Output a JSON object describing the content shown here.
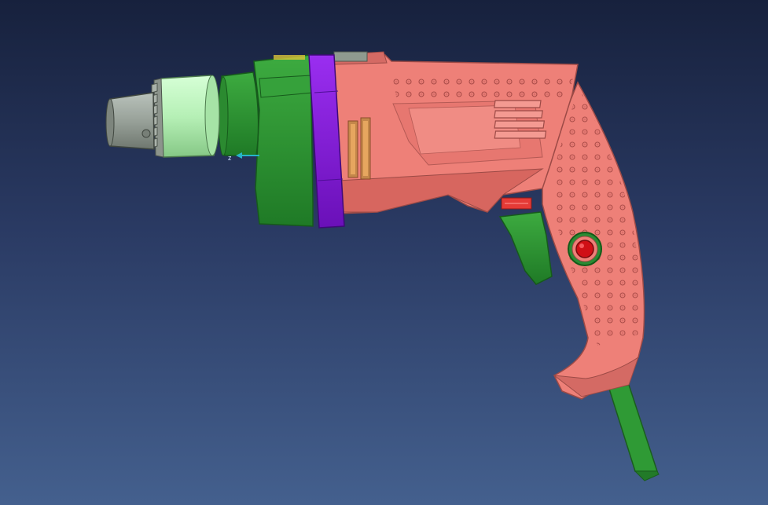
{
  "scene": {
    "model": "power-drill",
    "background_gradient": [
      "#17213d",
      "#44608e"
    ],
    "colors": {
      "chuck_metal": "#9aa39b",
      "chuck_sleeve": "#b6f0b6",
      "gear_housing": "#2f9a35",
      "collar": "#8a1fe0",
      "body": "#ee8078",
      "body_shadow": "#c25a55",
      "power_cord": "#2f9a35",
      "lock_button": "#d00f16",
      "axis_indicator": "#27b5c9"
    }
  }
}
